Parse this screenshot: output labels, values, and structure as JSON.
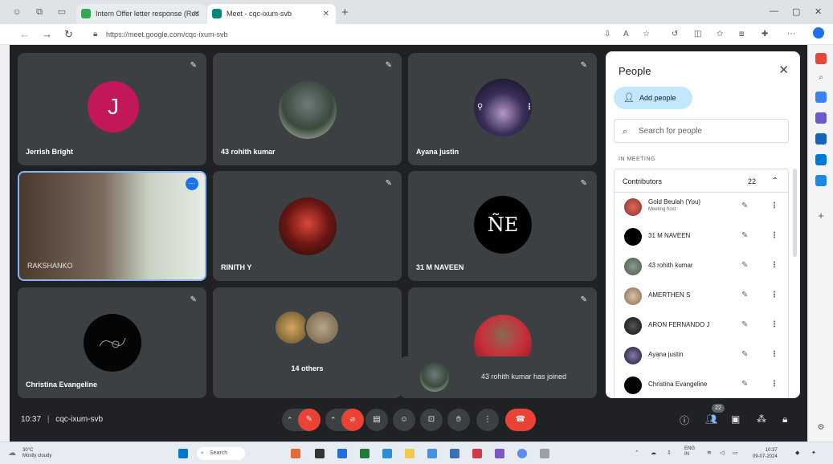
{
  "browser": {
    "tabs": [
      {
        "label": "Intern Offer letter response (Res",
        "active": false
      },
      {
        "label": "Meet - cqc-ixum-svb",
        "active": true
      }
    ],
    "url": "https://meet.google.com/cqc-ixum-svb"
  },
  "tiles": [
    {
      "name": "Jerrish Bright",
      "avatar_letter": "J",
      "avatar_color": "#c2185b"
    },
    {
      "name": "43 rohith kumar"
    },
    {
      "name": "Ayana justin"
    },
    {
      "name": "Gold Beulah (You)"
    },
    {
      "name": "RINITH Y"
    },
    {
      "name": "31 M NAVEEN",
      "avatar_text": "ÑE"
    },
    {
      "name": "Christina Evangeline"
    },
    {
      "name": "14 others"
    },
    {
      "name": ""
    }
  ],
  "self_tile_label": "RAKSHANKO",
  "people_panel": {
    "title": "People",
    "add_people_label": "Add people",
    "search_placeholder": "Search for people",
    "in_meeting_label": "IN MEETING",
    "contributors_label": "Contributors",
    "contributors_count": "22",
    "participants": [
      {
        "name": "Gold Beulah (You)",
        "sub": "Meeting host"
      },
      {
        "name": "31 M NAVEEN"
      },
      {
        "name": "43 rohith kumar"
      },
      {
        "name": "AMERTHEN S"
      },
      {
        "name": "ARON FERNANDO J"
      },
      {
        "name": "Ayana justin"
      },
      {
        "name": "Christina Evangeline"
      }
    ]
  },
  "toast": {
    "text": "43 rohith kumar has joined"
  },
  "controls": {
    "time": "10:37",
    "separator": "|",
    "meeting_code": "cqc-ixum-svb",
    "people_badge": "22"
  },
  "taskbar": {
    "weather_temp": "30°C",
    "weather_desc": "Mostly cloudy",
    "search_label": "Search",
    "lang": "ENG",
    "lang_sub": "IN",
    "clock_time": "10:37",
    "clock_date": "09-07-2024"
  },
  "colors": {
    "meet_bg": "#202124",
    "tile_bg": "#3c4043",
    "accent_blue": "#c2e7ff",
    "end_call_red": "#ea4335",
    "active_border": "#8ab4f8"
  }
}
